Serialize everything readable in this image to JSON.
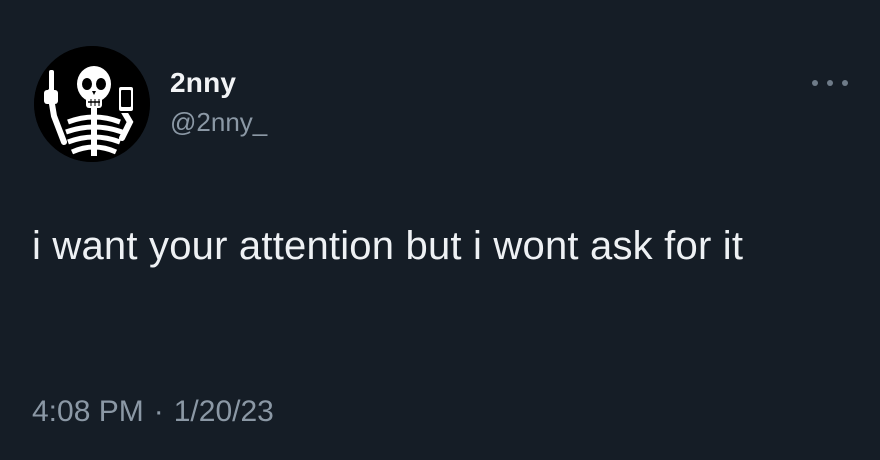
{
  "user": {
    "display_name": "2nny",
    "handle": "@2nny_",
    "avatar_icon": "skeleton-avatar"
  },
  "tweet": {
    "text": "i want your attention but i wont ask for it",
    "time": "4:08 PM",
    "separator": "·",
    "date": "1/20/23"
  },
  "more_icon": "more-dots-icon",
  "colors": {
    "background": "#151d26",
    "primary_text": "#eef1f4",
    "secondary_text": "#8b98a5"
  }
}
